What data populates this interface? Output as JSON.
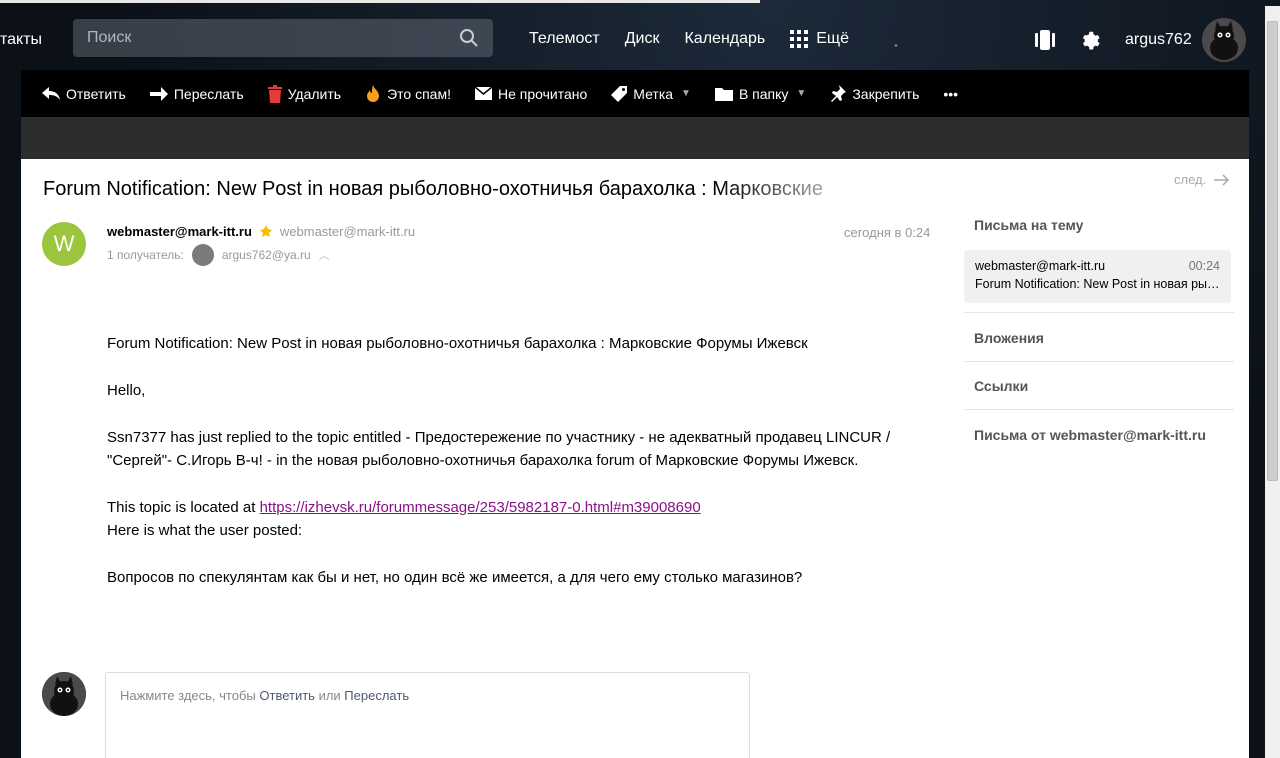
{
  "header": {
    "contacts_partial": "такты",
    "search_placeholder": "Поиск",
    "nav": [
      "Телемост",
      "Диск",
      "Календарь"
    ],
    "more_label": "Ещё",
    "username": "argus762"
  },
  "toolbar": {
    "reply": "Ответить",
    "forward": "Переслать",
    "delete": "Удалить",
    "spam": "Это спам!",
    "unread": "Не прочитано",
    "label": "Метка",
    "folder": "В папку",
    "pin": "Закрепить",
    "more": "•••"
  },
  "message": {
    "subject": "Forum Notification: New Post in новая рыболовно-охотничья барахолка : Марковские",
    "avatar_letter": "W",
    "sender_name": "webmaster@mark-itt.ru",
    "sender_email": "webmaster@mark-itt.ru",
    "recipients_label": "1 получатель:",
    "recipient": "argus762@ya.ru",
    "date": "сегодня в 0:24",
    "body": {
      "line1": "Forum Notification: New Post in новая рыболовно-охотничья барахолка : Марковские Форумы Ижевск",
      "greeting": "Hello,",
      "para": "Ssn7377 has just replied to the topic entitled - Предостережение по участнику - не адекватный продавец LINCUR / \"Сергей\"- С.Игорь В-ч! - in the новая рыболовно-охотничья барахолка forum of Марковские Форумы Ижевск.",
      "located_prefix": "This topic is located at ",
      "link": "https://izhevsk.ru/forummessage/253/5982187-0.html#m39008690",
      "posted": "Here is what the user posted:",
      "quote": "Вопросов по спекулянтам как бы и нет, но один всё же имеется, а для чего ему столько магазинов?"
    }
  },
  "reply_box": {
    "prefix": "Нажмите здесь, чтобы ",
    "reply": "Ответить",
    "or": " или ",
    "forward": "Переслать"
  },
  "right_panel": {
    "next": "след.",
    "thread_title": "Письма на тему",
    "thread_item": {
      "from": "webmaster@mark-itt.ru",
      "time": "00:24",
      "subject": "Forum Notification: New Post in новая рыболовно-охотничья барахолка"
    },
    "attachments": "Вложения",
    "links": "Ссылки",
    "from_sender": "Письма от webmaster@mark-itt.ru"
  },
  "colors": {
    "toolbar_bg": "#000000",
    "avatar_green": "#9bc53d",
    "link_purple": "#881188"
  }
}
